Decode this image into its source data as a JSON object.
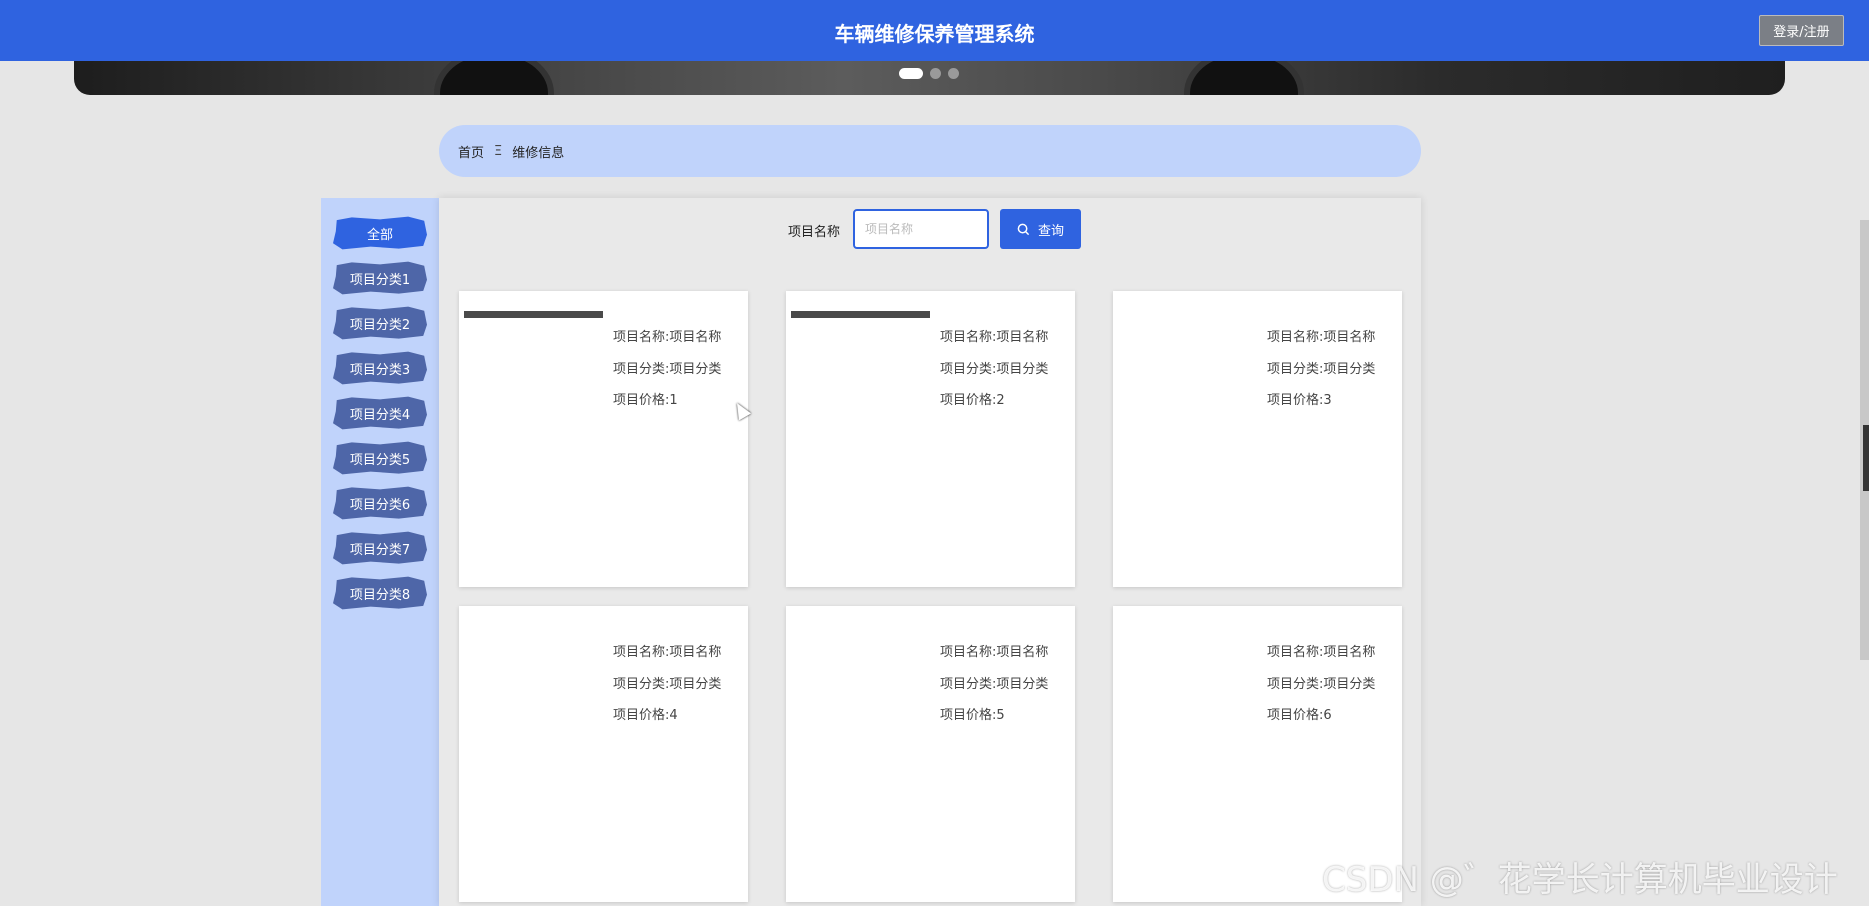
{
  "header": {
    "title": "车辆维修保养管理系统",
    "login_label": "登录/注册"
  },
  "banner": {
    "slide_count": 3,
    "active_index": 0
  },
  "breadcrumb": {
    "home": "首页",
    "separator": "Ξ",
    "current": "维修信息"
  },
  "sidebar": {
    "categories": [
      "全部",
      "项目分类1",
      "项目分类2",
      "项目分类3",
      "项目分类4",
      "项目分类5",
      "项目分类6",
      "项目分类7",
      "项目分类8"
    ]
  },
  "search": {
    "label": "项目名称",
    "placeholder": "项目名称",
    "button_label": "查询"
  },
  "cards": [
    {
      "name": "项目名称:项目名称",
      "category": "项目分类:项目分类",
      "price": "项目价格:1"
    },
    {
      "name": "项目名称:项目名称",
      "category": "项目分类:项目分类",
      "price": "项目价格:2"
    },
    {
      "name": "项目名称:项目名称",
      "category": "项目分类:项目分类",
      "price": "项目价格:3"
    },
    {
      "name": "项目名称:项目名称",
      "category": "项目分类:项目分类",
      "price": "项目价格:4"
    },
    {
      "name": "项目名称:项目名称",
      "category": "项目分类:项目分类",
      "price": "项目价格:5"
    },
    {
      "name": "项目名称:项目名称",
      "category": "项目分类:项目分类",
      "price": "项目价格:6"
    }
  ],
  "watermark": "CSDN @゛花学长计算机毕业设计",
  "colors": {
    "primary": "#2f63e0",
    "sidebar_bg": "#c0d3fb",
    "category_btn": "#4e66a8"
  }
}
